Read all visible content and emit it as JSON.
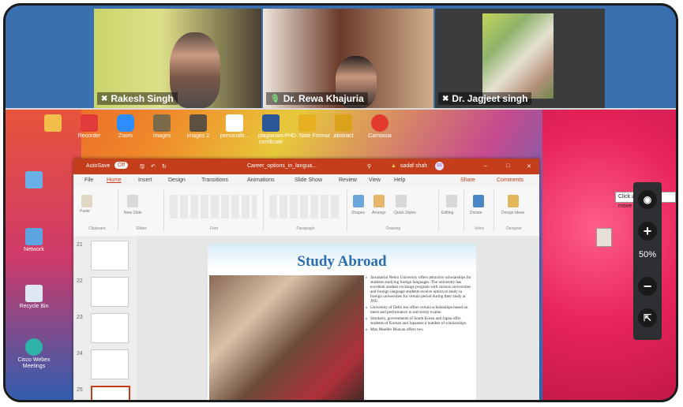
{
  "participants": [
    {
      "name": "Rakesh Singh",
      "mic": "muted"
    },
    {
      "name": "Dr. Rewa Khajuria",
      "mic": "active"
    },
    {
      "name": "Dr. Jagjeet singh",
      "mic": "muted"
    }
  ],
  "desktop_icons_top": [
    "",
    "Recorder",
    "Zoom",
    "Images",
    "images 2",
    "personalit...",
    "plagiarism certificate",
    "PHD. Note Format",
    "abstract",
    "Camtasia"
  ],
  "desktop_icons_left": [
    "",
    "Network",
    "Recycle Bin",
    "Cisco Webex Meetings"
  ],
  "powerpoint": {
    "autosave_label": "AutoSave",
    "autosave_state": "Off",
    "file_title": "Career_options_in_langua...",
    "user": "sadaf shah",
    "user_initials": "SS",
    "tabs": [
      "File",
      "Home",
      "Insert",
      "Design",
      "Transitions",
      "Animations",
      "Slide Show",
      "Review",
      "View",
      "Help"
    ],
    "share_label": "Share",
    "comments_label": "Comments",
    "ribbon_groups": [
      "Clipboard",
      "Slides",
      "Font",
      "Paragraph",
      "Drawing",
      "Voice",
      "Designer"
    ],
    "ribbon_buttons": {
      "paste": "Paste",
      "new_slide": "New Slide",
      "shapes": "Shapes",
      "arrange": "Arrange",
      "quick_styles": "Quick Styles",
      "editing": "Editing",
      "dictate": "Dictate",
      "design_ideas": "Design Ideas"
    },
    "slide_numbers": [
      "21",
      "22",
      "23",
      "24",
      "25"
    ],
    "slide": {
      "title": "Study Abroad",
      "bullets": [
        "Jawaharlal Nehru University offers attractive scholarships for students studying foreign languages. The university has excellent student exchange program with various universities and foreign language students receive option to study in foreign universities for certain period during their study at JNU.",
        "University of Delhi too offers certain scholarships based on merit and performance in university exams.",
        "Similarly, governments of South Korea and Japan offer students of Korean and Japanese a number of scholarships.",
        "Max Mueller Bhavan offers two"
      ]
    }
  },
  "zoom_controls": {
    "tooltip": "Click and hold to move",
    "zoom_level": "50%"
  },
  "colors": {
    "ppt_accent": "#c43e1c",
    "slide_title": "#2a6db0",
    "desktop_right": "#e8245a"
  }
}
